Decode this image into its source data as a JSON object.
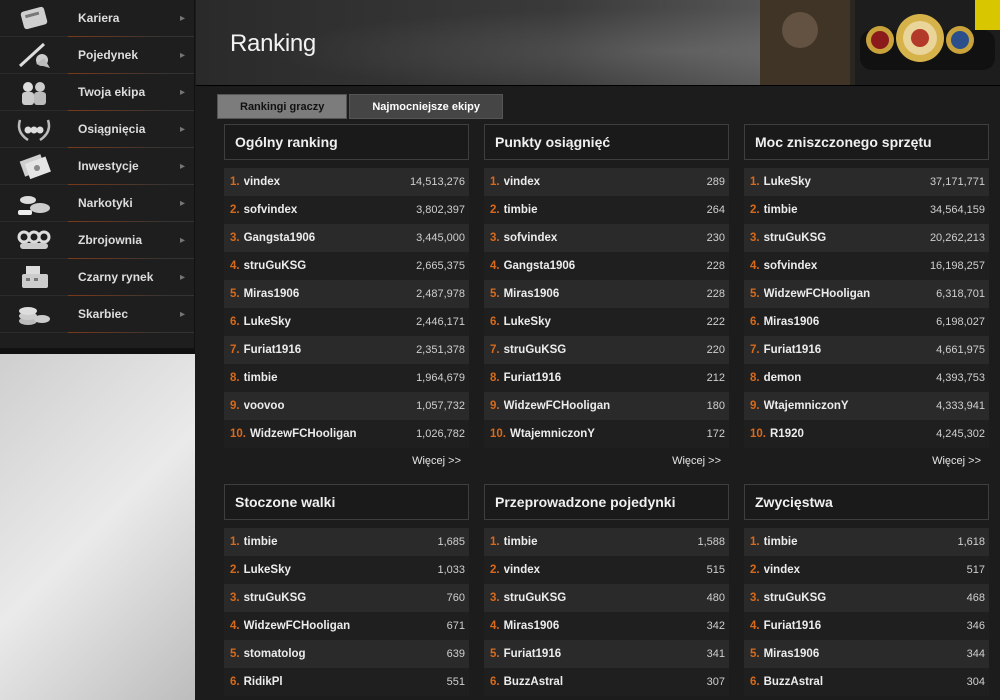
{
  "sidebar": {
    "items": [
      {
        "label": "Kariera",
        "icon": "scroll-icon"
      },
      {
        "label": "Pojedynek",
        "icon": "sword-fight-icon"
      },
      {
        "label": "Twoja ekipa",
        "icon": "gang-icon"
      },
      {
        "label": "Osiągnięcia",
        "icon": "laurel-knuckles-icon"
      },
      {
        "label": "Inwestycje",
        "icon": "money-stack-icon"
      },
      {
        "label": "Narkotyki",
        "icon": "drugs-icon"
      },
      {
        "label": "Zbrojownia",
        "icon": "brass-knuckles-icon"
      },
      {
        "label": "Czarny rynek",
        "icon": "cash-register-icon"
      },
      {
        "label": "Skarbiec",
        "icon": "coins-icon"
      }
    ]
  },
  "header": {
    "title": "Ranking"
  },
  "tabs": [
    {
      "label": "Rankingi graczy",
      "active": true
    },
    {
      "label": "Najmocniejsze ekipy",
      "active": false
    }
  ],
  "more_label": "Więcej >>",
  "panels": [
    {
      "title": "Ogólny ranking",
      "rows": [
        {
          "rank": "1.",
          "name": "vindex",
          "value": "14,513,276"
        },
        {
          "rank": "2.",
          "name": "sofvindex",
          "value": "3,802,397"
        },
        {
          "rank": "3.",
          "name": "Gangsta1906",
          "value": "3,445,000"
        },
        {
          "rank": "4.",
          "name": "struGuKSG",
          "value": "2,665,375"
        },
        {
          "rank": "5.",
          "name": "Miras1906",
          "value": "2,487,978"
        },
        {
          "rank": "6.",
          "name": "LukeSky",
          "value": "2,446,171"
        },
        {
          "rank": "7.",
          "name": "Furiat1916",
          "value": "2,351,378"
        },
        {
          "rank": "8.",
          "name": "timbie",
          "value": "1,964,679"
        },
        {
          "rank": "9.",
          "name": "voovoo",
          "value": "1,057,732"
        },
        {
          "rank": "10.",
          "name": "WidzewFCHooligan",
          "value": "1,026,782"
        }
      ]
    },
    {
      "title": "Punkty osiągnięć",
      "rows": [
        {
          "rank": "1.",
          "name": "vindex",
          "value": "289"
        },
        {
          "rank": "2.",
          "name": "timbie",
          "value": "264"
        },
        {
          "rank": "3.",
          "name": "sofvindex",
          "value": "230"
        },
        {
          "rank": "4.",
          "name": "Gangsta1906",
          "value": "228"
        },
        {
          "rank": "5.",
          "name": "Miras1906",
          "value": "228"
        },
        {
          "rank": "6.",
          "name": "LukeSky",
          "value": "222"
        },
        {
          "rank": "7.",
          "name": "struGuKSG",
          "value": "220"
        },
        {
          "rank": "8.",
          "name": "Furiat1916",
          "value": "212"
        },
        {
          "rank": "9.",
          "name": "WidzewFCHooligan",
          "value": "180"
        },
        {
          "rank": "10.",
          "name": "WtajemniczonY",
          "value": "172"
        }
      ]
    },
    {
      "title": "Moc zniszczonego sprzętu",
      "rows": [
        {
          "rank": "1.",
          "name": "LukeSky",
          "value": "37,171,771"
        },
        {
          "rank": "2.",
          "name": "timbie",
          "value": "34,564,159"
        },
        {
          "rank": "3.",
          "name": "struGuKSG",
          "value": "20,262,213"
        },
        {
          "rank": "4.",
          "name": "sofvindex",
          "value": "16,198,257"
        },
        {
          "rank": "5.",
          "name": "WidzewFCHooligan",
          "value": "6,318,701"
        },
        {
          "rank": "6.",
          "name": "Miras1906",
          "value": "6,198,027"
        },
        {
          "rank": "7.",
          "name": "Furiat1916",
          "value": "4,661,975"
        },
        {
          "rank": "8.",
          "name": "demon",
          "value": "4,393,753"
        },
        {
          "rank": "9.",
          "name": "WtajemniczonY",
          "value": "4,333,941"
        },
        {
          "rank": "10.",
          "name": "R1920",
          "value": "4,245,302"
        }
      ]
    },
    {
      "title": "Stoczone walki",
      "rows": [
        {
          "rank": "1.",
          "name": "timbie",
          "value": "1,685"
        },
        {
          "rank": "2.",
          "name": "LukeSky",
          "value": "1,033"
        },
        {
          "rank": "3.",
          "name": "struGuKSG",
          "value": "760"
        },
        {
          "rank": "4.",
          "name": "WidzewFCHooligan",
          "value": "671"
        },
        {
          "rank": "5.",
          "name": "stomatolog",
          "value": "639"
        },
        {
          "rank": "6.",
          "name": "RidikPl",
          "value": "551"
        }
      ]
    },
    {
      "title": "Przeprowadzone pojedynki",
      "rows": [
        {
          "rank": "1.",
          "name": "timbie",
          "value": "1,588"
        },
        {
          "rank": "2.",
          "name": "vindex",
          "value": "515"
        },
        {
          "rank": "3.",
          "name": "struGuKSG",
          "value": "480"
        },
        {
          "rank": "4.",
          "name": "Miras1906",
          "value": "342"
        },
        {
          "rank": "5.",
          "name": "Furiat1916",
          "value": "341"
        },
        {
          "rank": "6.",
          "name": "BuzzAstral",
          "value": "307"
        }
      ]
    },
    {
      "title": "Zwycięstwa",
      "rows": [
        {
          "rank": "1.",
          "name": "timbie",
          "value": "1,618"
        },
        {
          "rank": "2.",
          "name": "vindex",
          "value": "517"
        },
        {
          "rank": "3.",
          "name": "struGuKSG",
          "value": "468"
        },
        {
          "rank": "4.",
          "name": "Furiat1916",
          "value": "346"
        },
        {
          "rank": "5.",
          "name": "Miras1906",
          "value": "344"
        },
        {
          "rank": "6.",
          "name": "BuzzAstral",
          "value": "304"
        }
      ]
    }
  ]
}
